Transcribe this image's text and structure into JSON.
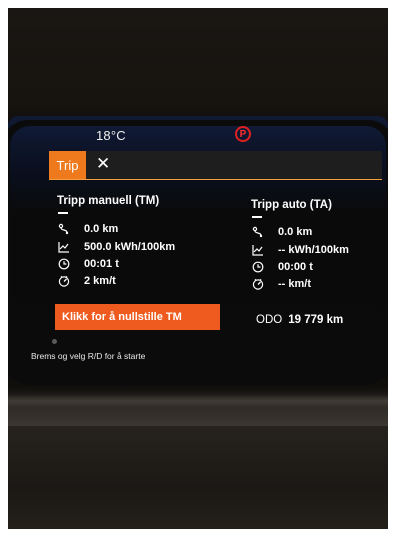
{
  "status": {
    "temperature": "18°C",
    "park_symbol": "P"
  },
  "header": {
    "tab_label": "Trip",
    "close_symbol": "✕"
  },
  "manual": {
    "title": "Tripp manuell (TM)",
    "distance": "0.0 km",
    "consumption": "500.0 kWh/100km",
    "time": "00:01 t",
    "speed": "2 km/t"
  },
  "auto": {
    "title": "Tripp auto (TA)",
    "distance": "0.0 km",
    "consumption": "-- kWh/100km",
    "time": "00:00 t",
    "speed": "-- km/t"
  },
  "reset_button": "Klikk for å nullstille TM",
  "odometer": {
    "label": "ODO",
    "value": "19 779 km"
  },
  "start_message": "Brems og velg R/D for å starte",
  "colors": {
    "accent": "#ee7a1d",
    "reset": "#ef5b1f",
    "park": "#e02020"
  },
  "icons": [
    "distance-icon",
    "consumption-graph-icon",
    "clock-icon",
    "speedometer-icon"
  ]
}
